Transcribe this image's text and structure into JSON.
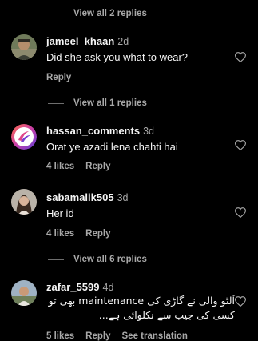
{
  "threads": [
    {
      "view_replies_label": "View all 2 replies"
    },
    {
      "username": "jameel_khaan",
      "time": "2d",
      "text": "Did she ask you what to wear?",
      "likes": "",
      "reply_label": "Reply",
      "view_replies_label": "View all 1 replies"
    },
    {
      "username": "hassan_comments",
      "time": "3d",
      "text": "Orat ye azadi lena chahti hai",
      "likes": "4 likes",
      "reply_label": "Reply"
    },
    {
      "username": "sabamalik505",
      "time": "3d",
      "text": "Her id",
      "likes": "4 likes",
      "reply_label": "Reply",
      "view_replies_label": "View all 6 replies"
    },
    {
      "username": "zafar_5599",
      "time": "4d",
      "text": "آلٹو والی نے گاڑی کی maintenance بھی تو کسی کی جیب سے نکلوائی ہے...",
      "likes": "5 likes",
      "reply_label": "Reply",
      "see_translation_label": "See translation"
    }
  ],
  "icons": {
    "like": "heart-outline-icon"
  },
  "colors": {
    "background": "#000000",
    "primary_text": "#f5f5f5",
    "secondary_text": "#a8a8a8"
  }
}
